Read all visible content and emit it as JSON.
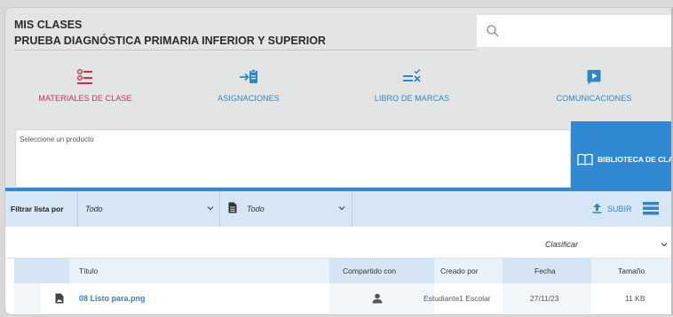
{
  "header": {
    "title": "MIS CLASES",
    "subtitle": "PRUEBA DIAGNÓSTICA PRIMARIA INFERIOR Y SUPERIOR"
  },
  "search": {
    "icon": "search-icon",
    "placeholder": ""
  },
  "nav": {
    "items": [
      {
        "label": "MATERIALES DE CLASE",
        "icon": "list-icon",
        "active": true
      },
      {
        "label": "ASIGNACIONES",
        "icon": "clipboard-arrow-icon",
        "active": false
      },
      {
        "label": "LIBRO DE MARCAS",
        "icon": "gradebook-icon",
        "active": false
      },
      {
        "label": "COMUNICACIONES",
        "icon": "message-icon",
        "active": false
      }
    ]
  },
  "product": {
    "placeholder": "Seleccione un producto"
  },
  "library_button": {
    "label": "BIBLIOTECA DE CLASE",
    "icon": "book-icon"
  },
  "filters": {
    "label": "Filtrar lista por",
    "type_value": "Todo",
    "doc_value": "Todo",
    "upload_label": "SUBIR",
    "list_view_icon": "list-view-icon"
  },
  "sort": {
    "label": "Clasificar"
  },
  "table": {
    "headers": {
      "title": "Título",
      "shared": "Compartido con",
      "created": "Creado por",
      "date": "Fecha",
      "size": "Tamaño"
    },
    "rows": [
      {
        "name": "08 Listo para.png",
        "created_by": "Estudiante1 Escolar",
        "date": "27/11/23",
        "size": "11 KB"
      }
    ]
  },
  "colors": {
    "accent_blue": "#3189d3",
    "active_red": "#d9284f",
    "header_gray": "#e3e5e5",
    "filter_bar": "#d6e6f4"
  }
}
